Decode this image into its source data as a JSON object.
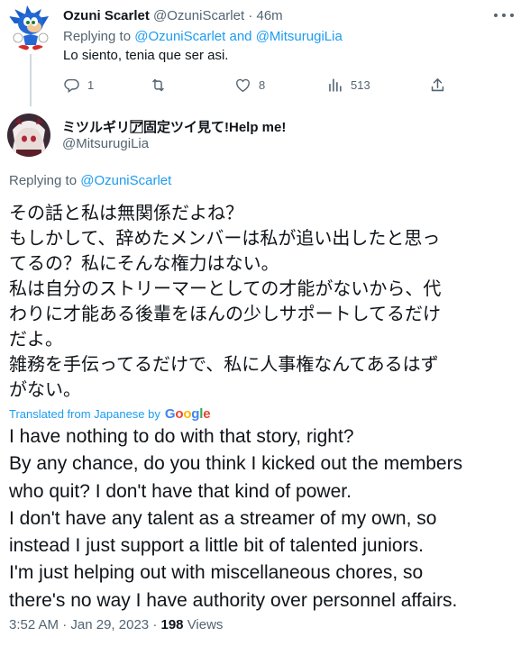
{
  "reply_tweet": {
    "display_name": "Ozuni Scarlet",
    "handle": "@OzuniScarlet",
    "separator": "·",
    "time": "46m",
    "replying_prefix": "Replying to",
    "replying_user1": "@OzuniScarlet",
    "replying_and": "and",
    "replying_user2": "@MitsurugiLia",
    "text": "Lo siento, tenia que ser asi.",
    "stats": {
      "replies": "1",
      "retweets": "",
      "likes": "8",
      "views": "513"
    }
  },
  "main_tweet": {
    "display_name": "ミツルギリア⃞固定ツイ見て!Help me!",
    "handle": "@MitsurugiLia",
    "replying_prefix": "Replying to",
    "replying_user": "@OzuniScarlet",
    "original_lines": [
      "その話と私は無関係だよね？",
      "もしかして、辞めたメンバーは私が追い出したと思っ",
      "てるの？私にそんな権力はない。",
      "私は自分のストリーマーとしての才能がないから、代",
      "わりに才能ある後輩をほんの少しサポートしてるだけ",
      "だよ。",
      "雑務を手伝ってるだけで、私に人事権なんてあるはず",
      "がない。"
    ],
    "translated_label": "Translated from Japanese by",
    "translation_provider": [
      "G",
      "o",
      "o",
      "g",
      "l",
      "e"
    ],
    "translated_lines": [
      "I have nothing to do with that story, right?",
      "By any chance, do you think I kicked out the members",
      "who quit? I don't have that kind of power.",
      "I don't have any talent as a streamer of my own, so",
      "instead I just support a little bit of talented juniors.",
      "I'm just helping out with miscellaneous chores, so",
      "there's no way I have authority over personnel affairs."
    ],
    "time": "3:52 AM",
    "date": "Jan 29, 2023",
    "separator": "·",
    "views_count": "198",
    "views_label": "Views"
  },
  "colors": {
    "link": "#1d9bf0",
    "secondary_text": "#536471",
    "primary_text": "#0f1419",
    "google": [
      "#4285F4",
      "#EA4335",
      "#FBBC05",
      "#4285F4",
      "#34A853",
      "#EA4335"
    ]
  },
  "icons": [
    "sonic-avatar",
    "more-icon",
    "reply-icon",
    "retweet-icon",
    "like-icon",
    "views-icon",
    "share-icon",
    "mitsurugi-avatar"
  ]
}
